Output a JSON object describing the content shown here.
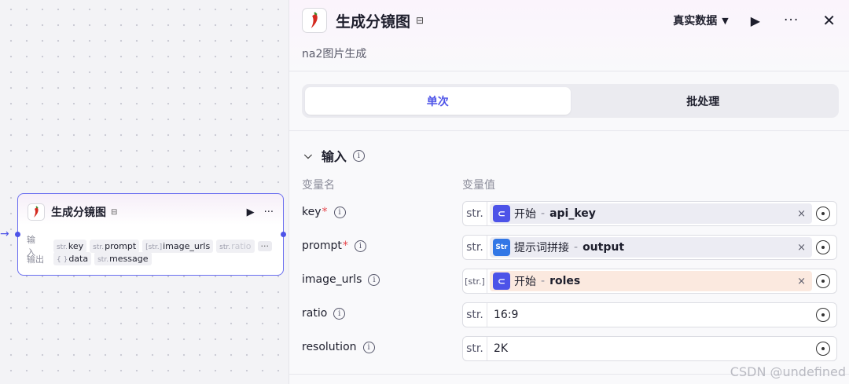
{
  "node": {
    "title": "生成分镜图",
    "inputs_label": "输入",
    "outputs_label": "输出",
    "inputs": [
      {
        "type": "str.",
        "name": "key"
      },
      {
        "type": "str.",
        "name": "prompt"
      },
      {
        "type": "[str.]",
        "name": "image_urls"
      },
      {
        "type": "str.",
        "name": "ratio"
      }
    ],
    "more_label": "···",
    "outputs": [
      {
        "type": "{ }",
        "name": "data"
      },
      {
        "type": "str.",
        "name": "message"
      }
    ]
  },
  "panel": {
    "title": "生成分镜图",
    "subtitle": "na2图片生成",
    "data_source": "真实数据",
    "tabs": [
      {
        "label": "单次",
        "active": true
      },
      {
        "label": "批处理",
        "active": false
      }
    ],
    "section": {
      "title": "输入",
      "col_name": "变量名",
      "col_value": "变量值",
      "rows": [
        {
          "name": "key",
          "required": "*",
          "type": "str.",
          "ref_node": "开始",
          "ref_var": "api_key",
          "ref_icon": "start-node-icon"
        },
        {
          "name": "prompt",
          "required": "*",
          "type": "str.",
          "ref_node": "提示词拼接",
          "ref_var": "output",
          "ref_icon": "string-node-icon"
        },
        {
          "name": "image_urls",
          "required": "",
          "type": "[str.]",
          "ref_node": "开始",
          "ref_var": "roles",
          "ref_icon": "start-node-icon",
          "mismatch": true
        },
        {
          "name": "ratio",
          "required": "",
          "type": "str.",
          "value": "16:9"
        },
        {
          "name": "resolution",
          "required": "",
          "type": "str.",
          "value": "2K"
        }
      ]
    }
  },
  "watermark": "CSDN @undefined",
  "colors": {
    "accent": "#4d53e8",
    "required": "#e5484d",
    "mismatch_bg": "#fbe9df"
  }
}
